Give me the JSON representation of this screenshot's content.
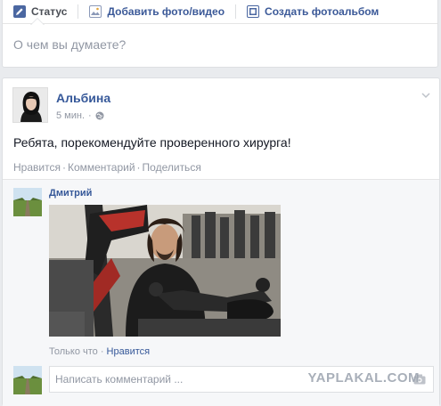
{
  "composer": {
    "tabs": [
      {
        "label": "Статус",
        "icon": "pencil-icon"
      },
      {
        "label": "Добавить фото/видео",
        "icon": "photo-icon"
      },
      {
        "label": "Создать фотоальбом",
        "icon": "album-icon"
      }
    ],
    "placeholder": "О чем вы думаете?"
  },
  "post": {
    "author": "Альбина",
    "time": "5 мин.",
    "text": "Ребята, порекомендуйте проверенного хирурга!",
    "actions": {
      "like": "Нравится",
      "comment": "Комментарий",
      "share": "Поделиться"
    }
  },
  "comment": {
    "author": "Дмитрий",
    "meta_time": "Только что",
    "meta_like": "Нравится"
  },
  "reply": {
    "placeholder": "Написать комментарий ..."
  },
  "watermark": "YAPLAKAL.COM",
  "colors": {
    "link": "#365899",
    "muted": "#9197a3",
    "background": "#e9ebee"
  }
}
